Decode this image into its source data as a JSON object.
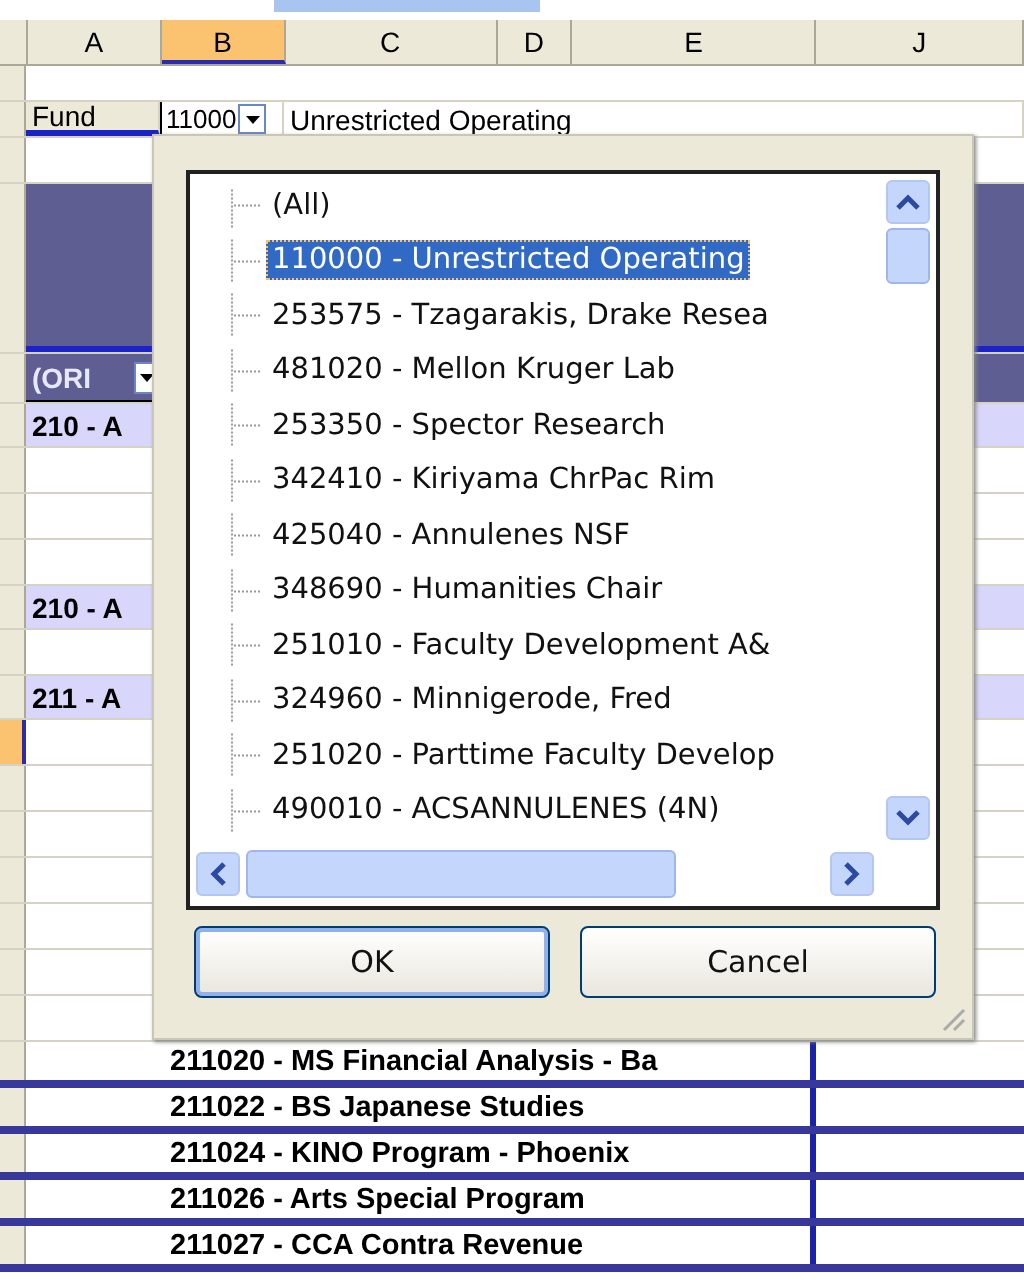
{
  "columns": [
    {
      "label": "A",
      "selected": false
    },
    {
      "label": "B",
      "selected": true
    },
    {
      "label": "C",
      "selected": false
    },
    {
      "label": "D",
      "selected": false
    },
    {
      "label": "E",
      "selected": false
    },
    {
      "label": "J",
      "selected": false
    }
  ],
  "rows": [
    {
      "kind": "blank",
      "selected": false
    },
    {
      "kind": "fund",
      "label": "Fund",
      "code": "11000",
      "name": "Unrestricted Operating",
      "selected": false
    },
    {
      "kind": "blank",
      "selected": false
    },
    {
      "kind": "band",
      "selected": false
    },
    {
      "kind": "header",
      "text": "(ORI",
      "selected": false
    },
    {
      "kind": "group",
      "text": "210 - A",
      "selected": false
    },
    {
      "kind": "blank",
      "selected": false
    },
    {
      "kind": "blank",
      "selected": false
    },
    {
      "kind": "blank",
      "selected": false
    },
    {
      "kind": "group",
      "text": "210 - A",
      "selected": false
    },
    {
      "kind": "blank",
      "selected": false
    },
    {
      "kind": "group",
      "text": "211 - A",
      "selected": false
    },
    {
      "kind": "blank",
      "selected": true
    },
    {
      "kind": "blank",
      "selected": false
    },
    {
      "kind": "blank",
      "selected": false
    },
    {
      "kind": "blank",
      "selected": false
    },
    {
      "kind": "blank",
      "selected": false
    },
    {
      "kind": "blank",
      "selected": false
    },
    {
      "kind": "blank",
      "selected": false
    },
    {
      "kind": "detail",
      "text": "211020 - MS Financial Analysis - Ba",
      "selected": false
    },
    {
      "kind": "detail",
      "text": "211022 - BS Japanese Studies",
      "selected": false
    },
    {
      "kind": "detail",
      "text": "211024 - KINO Program - Phoenix",
      "selected": false
    },
    {
      "kind": "detail",
      "text": "211026 - Arts Special  Program",
      "selected": false
    },
    {
      "kind": "detail",
      "text": "211027 - CCA Contra Revenue",
      "selected": false
    }
  ],
  "dialog": {
    "items": [
      {
        "label": "(All)",
        "selected": false
      },
      {
        "label": "110000 - Unrestricted Operating",
        "selected": true
      },
      {
        "label": "253575 - Tzagarakis, Drake Resea",
        "selected": false
      },
      {
        "label": "481020 - Mellon Kruger Lab",
        "selected": false
      },
      {
        "label": "253350 - Spector Research",
        "selected": false
      },
      {
        "label": "342410 - Kiriyama ChrPac Rim",
        "selected": false
      },
      {
        "label": "425040 - Annulenes NSF",
        "selected": false
      },
      {
        "label": "348690 - Humanities Chair",
        "selected": false
      },
      {
        "label": "251010 - Faculty Development A&",
        "selected": false
      },
      {
        "label": "324960 - Minnigerode, Fred",
        "selected": false
      },
      {
        "label": "251020 - Parttime Faculty Develop",
        "selected": false
      },
      {
        "label": "490010 - ACSANNULENES (4N)",
        "selected": false
      }
    ],
    "buttons": [
      {
        "label": "OK",
        "default": true
      },
      {
        "label": "Cancel",
        "default": false
      }
    ]
  }
}
